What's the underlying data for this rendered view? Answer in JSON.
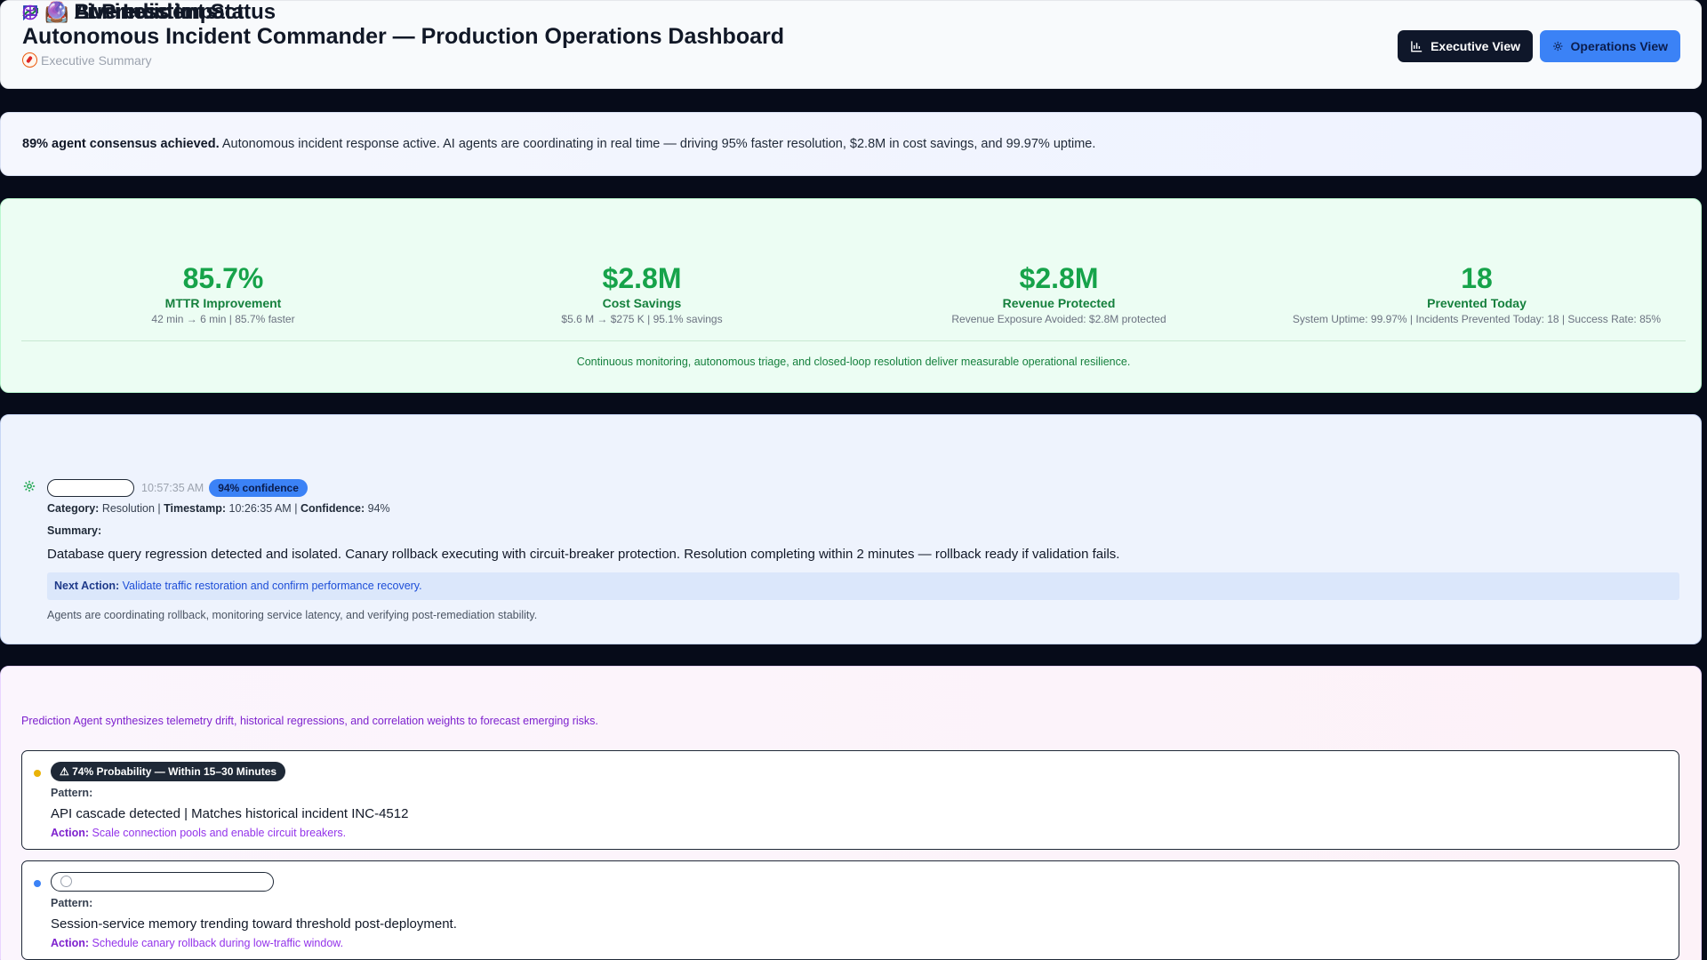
{
  "header": {
    "title": "Autonomous Incident Commander — Production Operations Dashboard",
    "subtitle": "Executive Summary",
    "exec_button": "Executive View",
    "ops_button": "Operations View"
  },
  "banner": {
    "bold": "89% agent consensus achieved.",
    "text": " Autonomous incident response active. AI agents are coordinating in real time — driving 95% faster resolution, $2.8M in cost savings, and 99.97% uptime."
  },
  "impact": {
    "emoji": "💼",
    "title": "Business Impact",
    "kpis": [
      {
        "value": "85.7%",
        "label": "MTTR Improvement",
        "sub": "42 min → 6 min | 85.7% faster"
      },
      {
        "value": "$2.8M",
        "label": "Cost Savings",
        "sub": "$5.6 M → $275 K | 95.1% savings"
      },
      {
        "value": "$2.8M",
        "label": "Revenue Protected",
        "sub": "Revenue Exposure Avoided: $2.8M protected"
      },
      {
        "value": "18",
        "label": "Prevented Today",
        "sub": "System Uptime: 99.97% | Incidents Prevented Today: 18 | Success Rate: 85%"
      }
    ],
    "footer": "Continuous monitoring, autonomous triage, and closed-loop resolution deliver measurable operational resilience."
  },
  "incident": {
    "emoji": "🚨",
    "title": "Live Incident Status",
    "time": "10:57:35 AM",
    "confidence_badge": "94% confidence",
    "category_label": "Category:",
    "category": "Resolution",
    "timestamp_label": "Timestamp:",
    "timestamp": "10:26:35 AM",
    "confidence_label": "Confidence:",
    "confidence": "94%",
    "summary_label": "Summary:",
    "summary": "Database query regression detected and isolated. Canary rollback executing with circuit-breaker protection. Resolution completing within 2 minutes — rollback ready if validation fails.",
    "next_label": "Next Action:",
    "next_action": "Validate traffic restoration and confirm performance recovery.",
    "agents_text": "Agents are coordinating rollback, monitoring service latency, and verifying post-remediation stability."
  },
  "predictions": {
    "emoji": "🔮",
    "title": "AI Predictions",
    "description": "Prediction Agent synthesizes telemetry drift, historical regressions, and correlation weights to forecast emerging risks.",
    "items": [
      {
        "badge": "⚠ 74% Probability — Within 15–30 Minutes",
        "pattern_label": "Pattern:",
        "pattern": "API cascade detected | Matches historical incident INC-4512",
        "action_label": "Action:",
        "action": "Scale connection pools and enable circuit breakers.",
        "dot_color": "#eab308"
      },
      {
        "badge": "",
        "pattern_label": "Pattern:",
        "pattern": "Session-service memory trending toward threshold post-deployment.",
        "action_label": "Action:",
        "action": "Schedule canary rollback during low-traffic window.",
        "dot_color": "#3b82f6"
      }
    ]
  }
}
